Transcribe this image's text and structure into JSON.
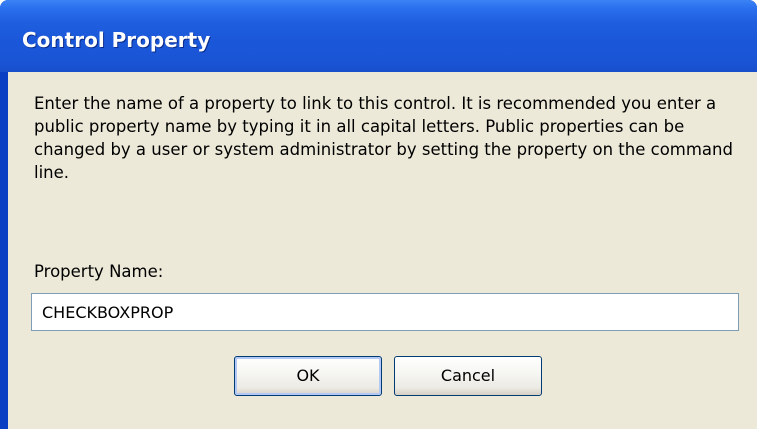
{
  "window": {
    "title": "Control Property"
  },
  "dialog": {
    "description": "Enter the name of a property to link to this control. It is recommended you enter a public property name by typing it in all capital letters. Public properties can be changed by a user or system administrator by setting the property on the command line.",
    "property_name_label": "Property Name:",
    "property_name_value": "CHECKBOXPROP"
  },
  "buttons": {
    "ok_label": "OK",
    "cancel_label": "Cancel"
  },
  "colors": {
    "titlebar": "#1a56d8",
    "dialog_background": "#ece9d8",
    "input_border": "#7f9db9",
    "button_border": "#003c74"
  }
}
